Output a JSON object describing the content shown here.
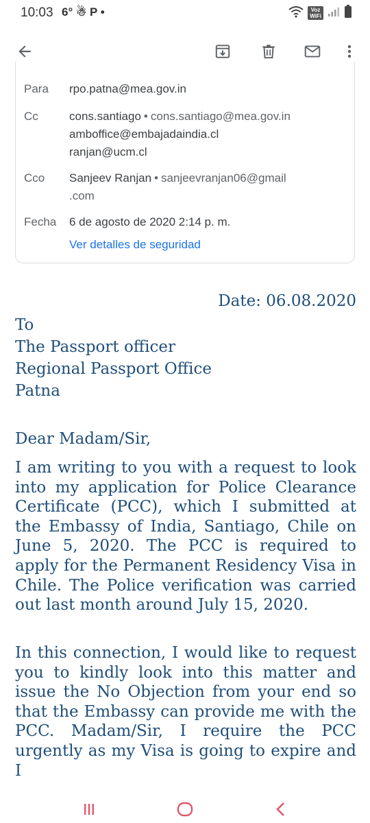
{
  "status_bar": {
    "time": "10:03",
    "extra": "6° ☃ P •",
    "voz_top": "Voz",
    "voz_bottom": "WiFi"
  },
  "toolbar": {
    "back_icon": "arrow-back-icon",
    "archive_icon": "archive-icon",
    "delete_icon": "trash-icon",
    "mark_unread_icon": "mail-icon",
    "more_icon": "more-vert-icon"
  },
  "details": {
    "para_label": "Para",
    "para_value": "rpo.patna@mea.gov.in",
    "cc_label": "Cc",
    "cc_name": "cons.santiago",
    "cc_email": "cons.santiago@mea.gov.in",
    "cc_line2": "amboffice@embajadaindia.cl",
    "cc_line3": "ranjan@ucm.cl",
    "cco_label": "Cco",
    "cco_name": "Sanjeev Ranjan",
    "cco_email_1": "sanjeevranjan06@gmail",
    "cco_email_2": ".com",
    "fecha_label": "Fecha",
    "fecha_value": "6 de agosto de 2020 2:14 p. m.",
    "security_link": "Ver detalles de seguridad"
  },
  "letter": {
    "date": "Date: 06.08.2020",
    "to": "To",
    "recipient_1": "The Passport officer",
    "recipient_2": "Regional Passport Office",
    "recipient_3": "Patna",
    "greeting": "Dear Madam/Sir,",
    "para1": "I am writing to you with a request to look into my application for Police Clearance Certificate (PCC), which I submitted at the Embassy of India, Santiago, Chile on June 5, 2020. The PCC is required to apply for the Permanent Residency Visa in Chile. The Police verification was carried out last month around July 15, 2020.",
    "para2": "In this connection, I would like to request you to kindly look into this matter and issue the No Objection from your end so that the Embassy can provide me with the PCC. Madam/Sir, I require the PCC urgently as my Visa is going to expire and I"
  },
  "nav_bar": {
    "recents_icon": "recents-icon",
    "home_icon": "home-icon",
    "back_icon": "nav-back-icon"
  },
  "colors": {
    "letter_text": "#1f4e79",
    "link": "#1a73e8",
    "nav_accent": "#e0576e"
  }
}
